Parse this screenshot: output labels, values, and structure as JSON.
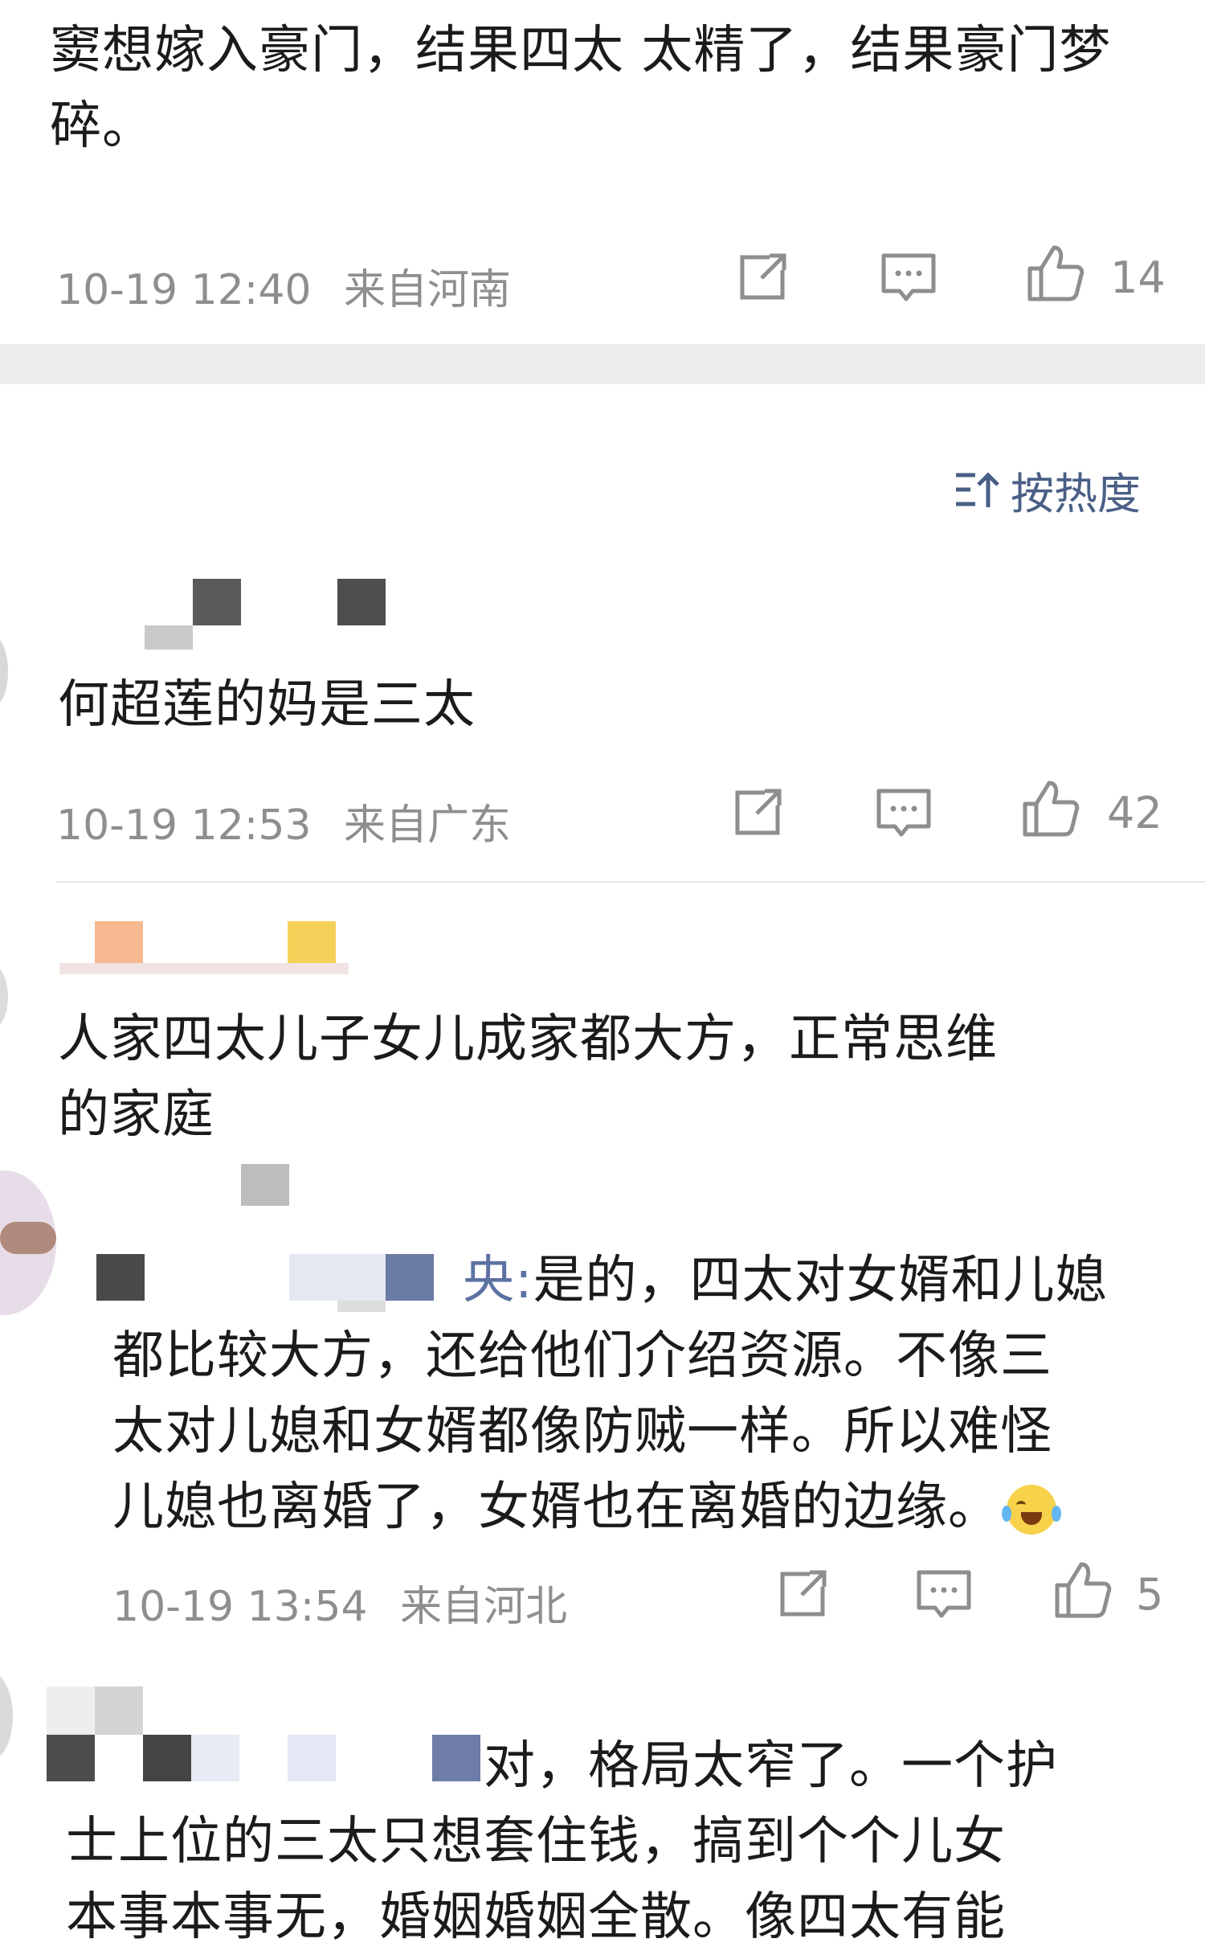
{
  "comments": [
    {
      "text": "窦想嫁入豪门，结果四太 太精了，结果豪门梦碎。",
      "date": "10-19 12:40",
      "location": "来自河南",
      "likes": "14"
    },
    {
      "text": "何超莲的妈是三太",
      "date": "10-19 12:53",
      "location": "来自广东",
      "likes": "42"
    },
    {
      "text_line1": "人家四太儿子女儿成家都大方，正常思维",
      "text_line2": "的家庭"
    }
  ],
  "sort": {
    "label": "按热度"
  },
  "reply1": {
    "name_tail": "央:",
    "line1": "是的，四太对女婿和儿媳",
    "line2": "都比较大方，还给他们介绍资源。不像三",
    "line3": "太对儿媳和女婿都像防贼一样。所以难怪",
    "line4": "儿媳也离婚了，女婿也在离婚的边缘。",
    "date": "10-19 13:54",
    "location": "来自河北",
    "likes": "5"
  },
  "reply2": {
    "line1": "对，格局太窄了。一个护",
    "line2": "士上位的三太只想套住钱，搞到个个儿女",
    "line3": "本事本事无，婚姻婚姻全散。像四太有能"
  },
  "colors": {
    "meta": "#8e8e8e",
    "sort": "#4a5f86",
    "band": "#ececec"
  },
  "icons": [
    "share-icon",
    "comment-icon",
    "thumbs-up-icon",
    "sort-icon"
  ]
}
